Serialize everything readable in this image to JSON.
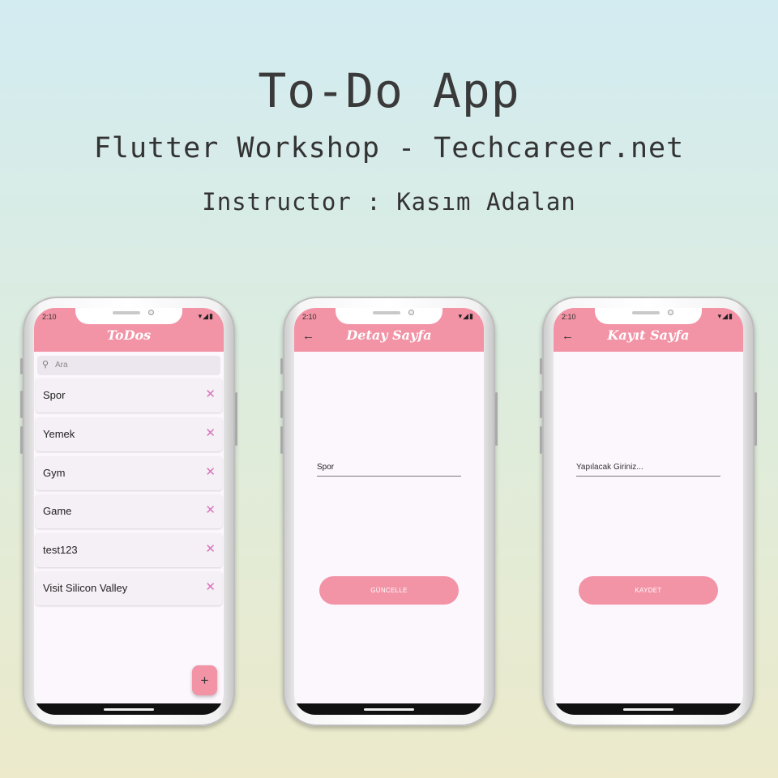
{
  "hero": {
    "title": "To-Do App",
    "subtitle": "Flutter Workshop - Techcareer.net",
    "instructor": "Instructor : Kasım Adalan"
  },
  "status_bar": {
    "time": "2:10"
  },
  "colors": {
    "accent": "#f293a6",
    "delete_icon": "#d874b9",
    "screen_bg": "#fcf7fd"
  },
  "list_screen": {
    "title": "ToDos",
    "search_placeholder": "Ara",
    "items": [
      {
        "label": "Spor"
      },
      {
        "label": "Yemek"
      },
      {
        "label": "Gym"
      },
      {
        "label": "Game"
      },
      {
        "label": "test123"
      },
      {
        "label": "Visit Silicon Valley"
      }
    ],
    "fab_icon": "+"
  },
  "detail_screen": {
    "title": "Detay Sayfa",
    "field_value": "Spor",
    "button_label": "GÜNCELLE"
  },
  "register_screen": {
    "title": "Kayıt Sayfa",
    "field_placeholder": "Yapılacak Giriniz...",
    "button_label": "KAYDET"
  }
}
